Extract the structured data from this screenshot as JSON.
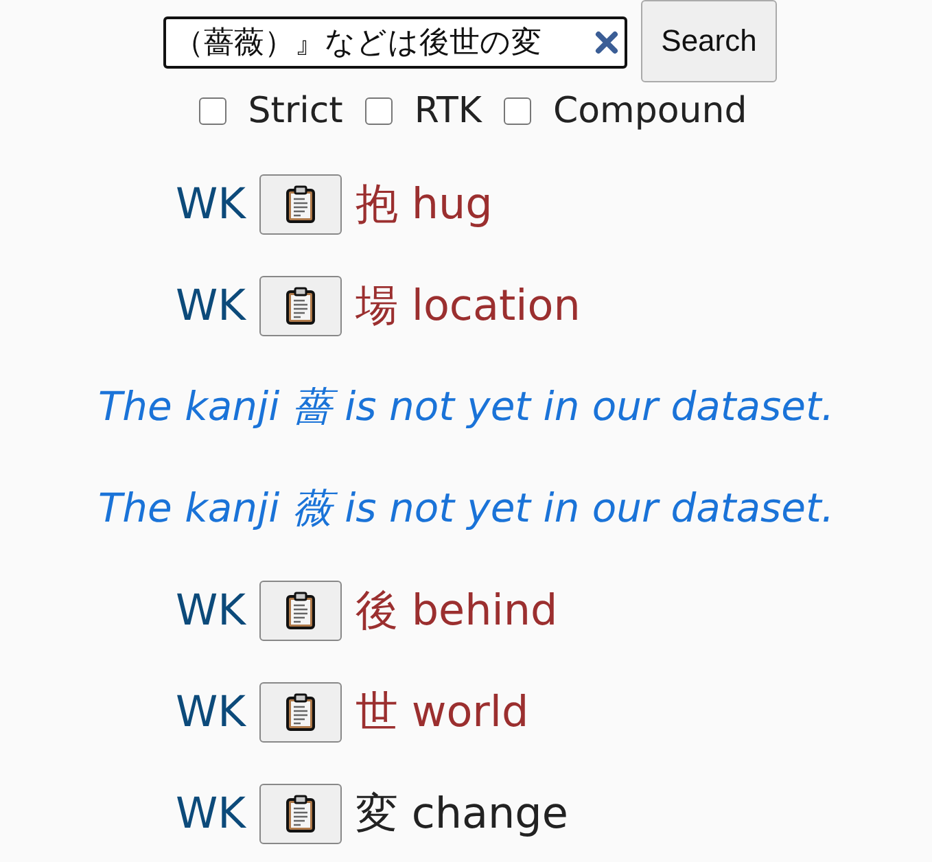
{
  "search": {
    "value": "（薔薇）』などは後世の変",
    "button": "Search"
  },
  "options": [
    {
      "label": "Strict",
      "checked": false
    },
    {
      "label": "RTK",
      "checked": false
    },
    {
      "label": "Compound",
      "checked": false
    }
  ],
  "results": [
    {
      "kind": "entry",
      "source": "WK",
      "kanji": "抱",
      "meaning": "hug",
      "color": "#9b2f2f"
    },
    {
      "kind": "entry",
      "source": "WK",
      "kanji": "場",
      "meaning": "location",
      "color": "#9b2f2f"
    },
    {
      "kind": "missing",
      "text": "The kanji 薔 is not yet in our dataset."
    },
    {
      "kind": "missing",
      "text": "The kanji 薇 is not yet in our dataset."
    },
    {
      "kind": "entry",
      "source": "WK",
      "kanji": "後",
      "meaning": "behind",
      "color": "#9b2f2f"
    },
    {
      "kind": "entry",
      "source": "WK",
      "kanji": "世",
      "meaning": "world",
      "color": "#9b2f2f"
    },
    {
      "kind": "entry",
      "source": "WK",
      "kanji": "変",
      "meaning": "change",
      "color": "#222222"
    }
  ]
}
